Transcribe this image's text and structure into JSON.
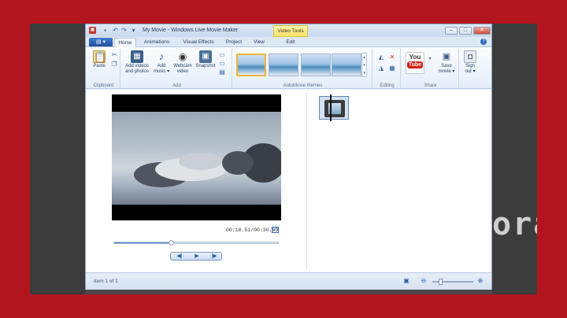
{
  "window": {
    "title": "My Movie - Windows Live Movie Maker",
    "context_tab": "Video Tools"
  },
  "tabs": [
    "Home",
    "Animations",
    "Visual Effects",
    "Project",
    "View",
    "Edit"
  ],
  "ribbon": {
    "clipboard": {
      "paste": "Paste",
      "group_label": "Clipboard"
    },
    "add": {
      "add_videos_line1": "Add videos",
      "add_videos_line2": "and photos",
      "add_music_line1": "Add",
      "add_music_line2": "music ▾",
      "webcam_line1": "Webcam",
      "webcam_line2": "video",
      "snapshot": "Snapshot",
      "group_label": "Add"
    },
    "automovie": {
      "group_label": "AutoMovie themes"
    },
    "editing": {
      "group_label": "Editing"
    },
    "share": {
      "youtube_you": "You",
      "youtube_tube": "Tube",
      "save_movie_line1": "Save",
      "save_movie_line2": "movie ▾",
      "sign_out_line1": "Sign",
      "sign_out_line2": "out ▾",
      "group_label": "Share"
    }
  },
  "preview": {
    "timecode": "00:10.51/00:30.09",
    "progress": 0.35
  },
  "status": {
    "text": "Item 1 of 1"
  },
  "background": {
    "text": "ora"
  },
  "colors": {
    "frame_red": "#b3151e",
    "accent_blue": "#2b6cc4",
    "context_yellow": "#f7e36a"
  }
}
